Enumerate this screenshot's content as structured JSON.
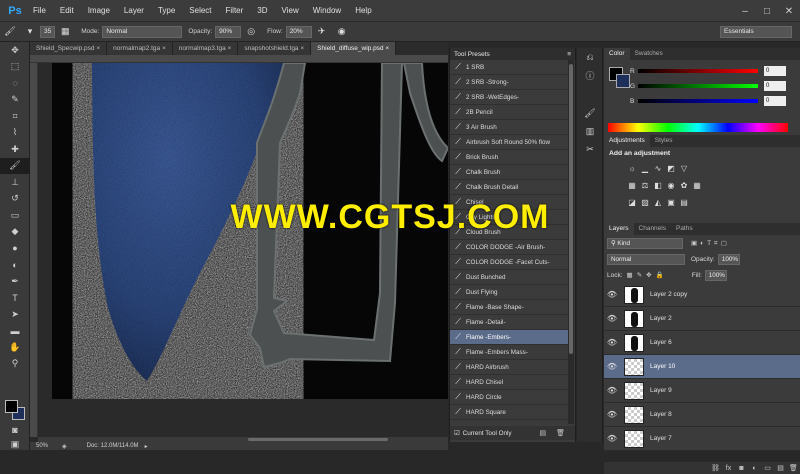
{
  "menubar": {
    "logo": "Ps",
    "items": [
      "File",
      "Edit",
      "Image",
      "Layer",
      "Type",
      "Select",
      "Filter",
      "3D",
      "View",
      "Window",
      "Help"
    ]
  },
  "options": {
    "brush_size": "35",
    "mode_label": "Mode:",
    "mode_value": "Normal",
    "opacity_label": "Opacity:",
    "opacity_value": "90%",
    "flow_label": "Flow:",
    "flow_value": "20%",
    "workspace": "Essentials"
  },
  "doc_tabs": [
    {
      "label": "Shield_Specwip.psd"
    },
    {
      "label": "normalmap2.tga"
    },
    {
      "label": "normalmap3.tga"
    },
    {
      "label": "snapshotshield.tga"
    },
    {
      "label": "Shield_diffuse_wip.psd"
    }
  ],
  "status": {
    "zoom": "50%",
    "doc": "Doc: 12.0M/114.0M"
  },
  "tool_presets": {
    "title": "Tool Presets",
    "items": [
      "1 SRB",
      "2 SRB -Strong-",
      "2 SRB -WetEdges-",
      "2B Pencil",
      "3 Air Brush",
      "Airbrush Soft Round 50% flow",
      "Brick Brush",
      "Chalk Brush",
      "Chalk Brush Detail",
      "Chisel",
      "City Lights",
      "Cloud Brush",
      "COLOR DODGE -Air Brush-",
      "COLOR DODGE -Facet Cuts-",
      "Dust Bunched",
      "Dust Flying",
      "Flame -Base Shape-",
      "Flame -Detail-",
      "Flame -Embers-",
      "Flame -Embers Mass-",
      "HARD Airbrush",
      "HARD Chisel",
      "HARD Circle",
      "HARD Square"
    ],
    "selected_index": 18,
    "footer_label": "Current Tool Only"
  },
  "color_panel": {
    "tabs": [
      "Color",
      "Swatches"
    ],
    "r_label": "R",
    "g_label": "G",
    "b_label": "B",
    "r_value": "0",
    "g_value": "0",
    "b_value": "0",
    "fg_color": "#000000",
    "bg_color": "#1d2f5a"
  },
  "adjustments": {
    "tabs": [
      "Adjustments",
      "Styles"
    ],
    "title": "Add an adjustment"
  },
  "layers": {
    "tabs": [
      "Layers",
      "Channels",
      "Paths"
    ],
    "filter": "Kind",
    "blend_mode": "Normal",
    "opacity_label": "Opacity:",
    "opacity_value": "100%",
    "lock_label": "Lock:",
    "fill_label": "Fill:",
    "fill_value": "100%",
    "items": [
      {
        "name": "Layer 2 copy",
        "thumb": "dark"
      },
      {
        "name": "Layer 2",
        "thumb": "dark"
      },
      {
        "name": "Layer 6",
        "thumb": "dark"
      },
      {
        "name": "Layer 10",
        "thumb": "clear"
      },
      {
        "name": "Layer 9",
        "thumb": "clear"
      },
      {
        "name": "Layer 8",
        "thumb": "clear"
      },
      {
        "name": "Layer 7",
        "thumb": "clear"
      }
    ],
    "selected_index": 3
  },
  "watermark": "WWW.CGTSJ.COM",
  "colors": {
    "accent": "#31a8ff",
    "selection": "#5b6b8a",
    "watermark": "#ffee00"
  }
}
